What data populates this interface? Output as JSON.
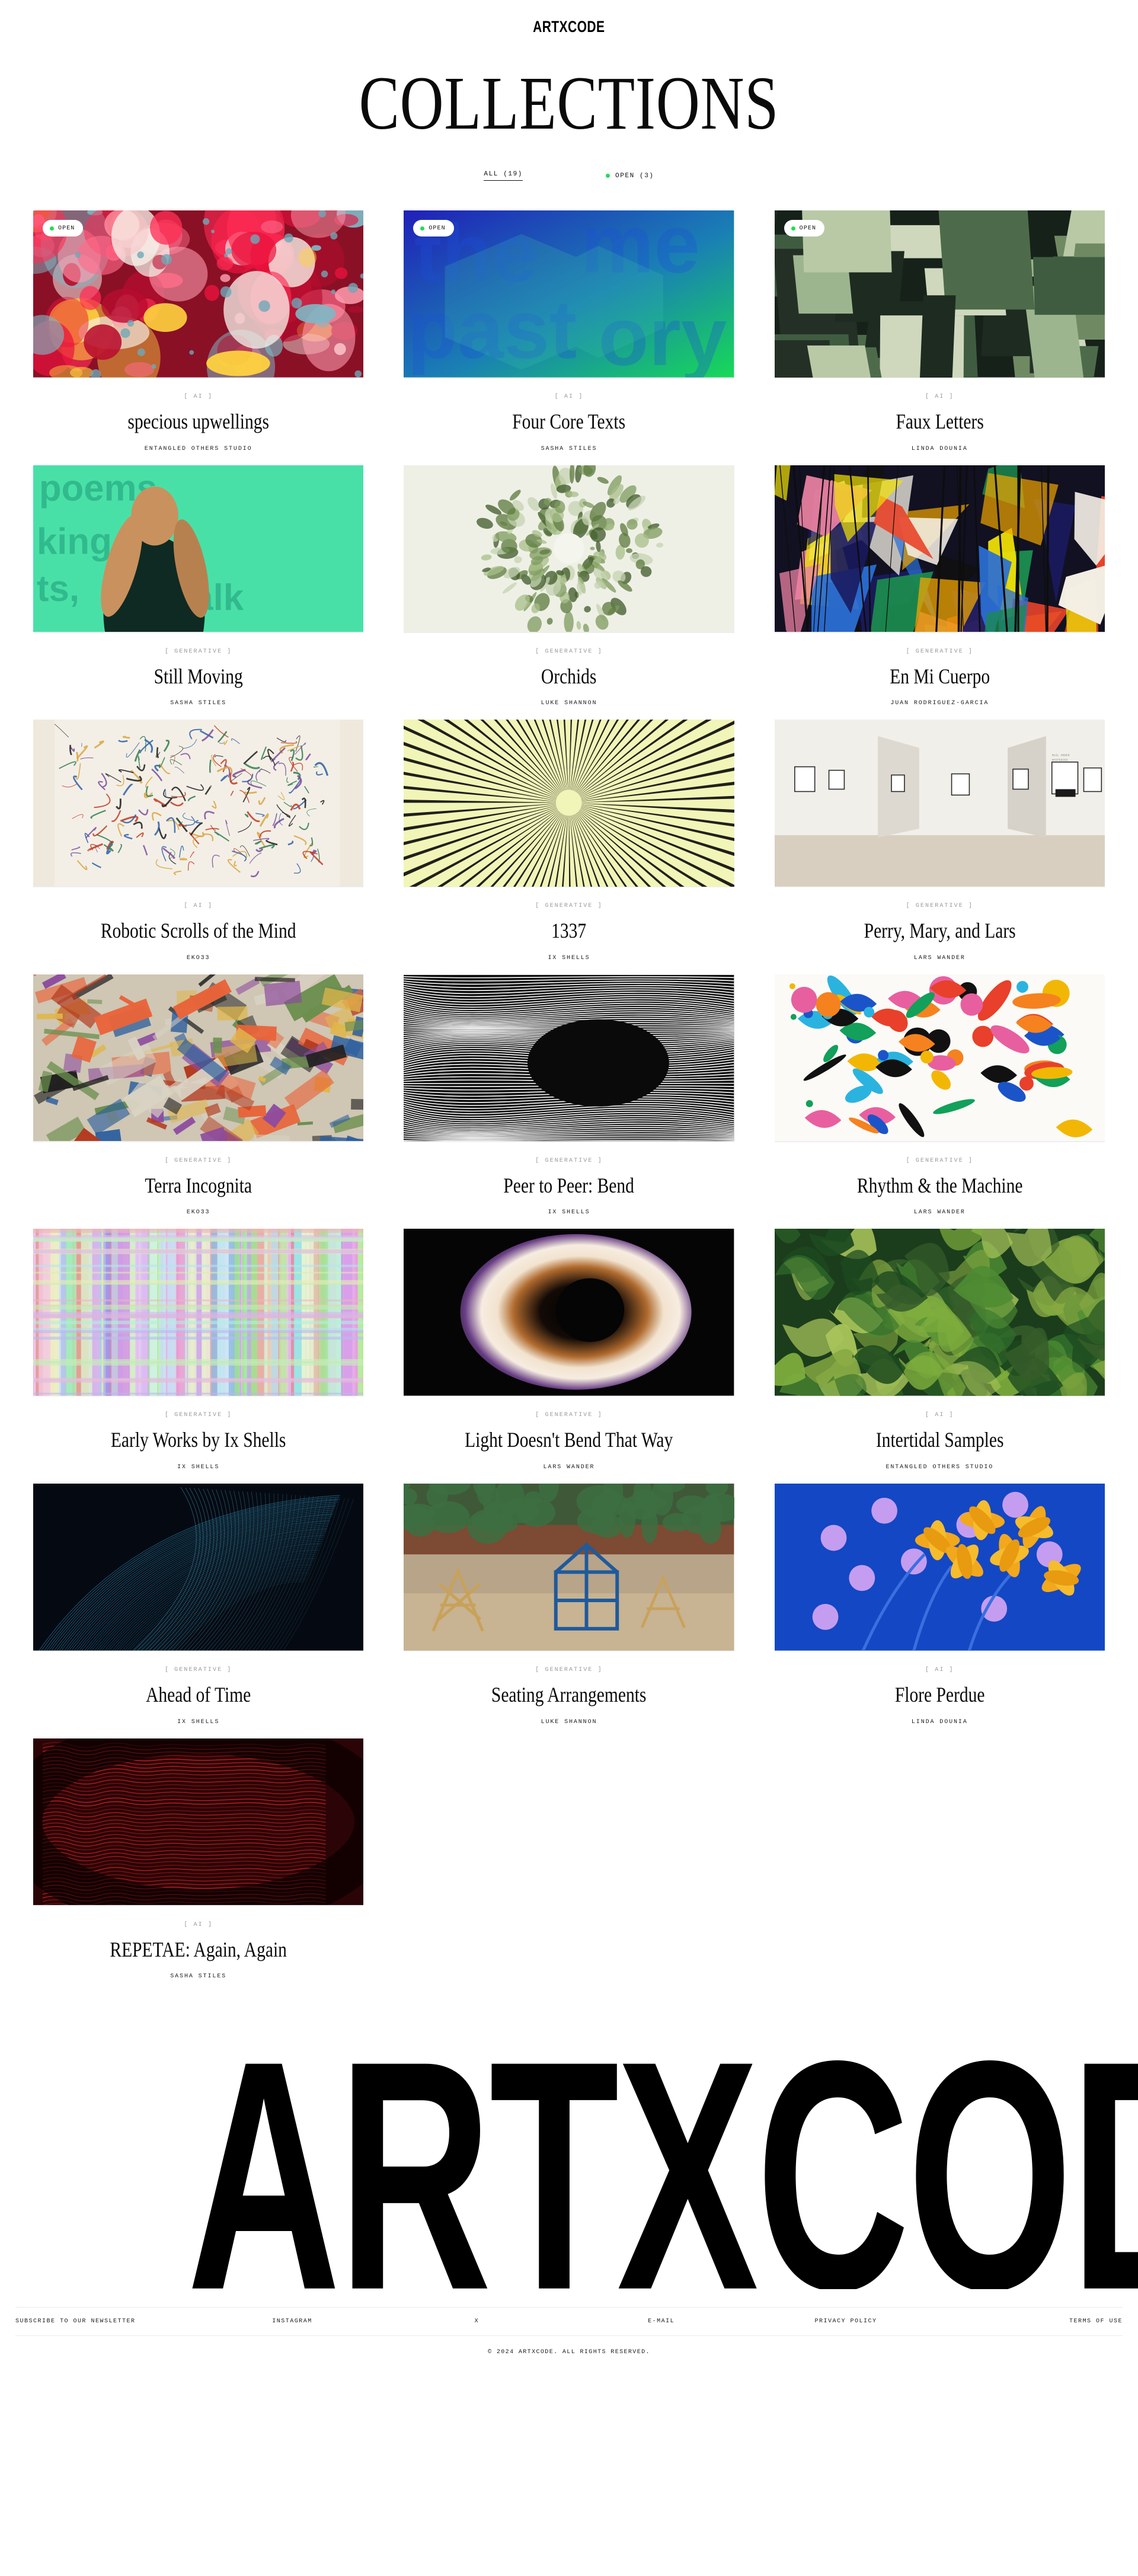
{
  "header": {
    "logo": "ARTXCODE"
  },
  "page": {
    "title": "COLLECTIONS"
  },
  "filters": [
    {
      "label": "ALL (19)",
      "active": true,
      "dot": false
    },
    {
      "label": "OPEN (3)",
      "active": false,
      "dot": true
    }
  ],
  "badge": {
    "open_label": "OPEN"
  },
  "colors": {
    "accent_green": "#22dd55",
    "text": "#0a0a0a",
    "muted": "#9a9a9a",
    "rule": "#ececec"
  },
  "collections": [
    {
      "title": "specious upwellings",
      "category": "[ AI ]",
      "artist": "ENTANGLED OTHERS STUDIO",
      "open": true,
      "art": "coral-bloom"
    },
    {
      "title": "Four Core Texts",
      "category": "[ AI ]",
      "artist": "SASHA STILES",
      "open": true,
      "art": "blue-green-type"
    },
    {
      "title": "Faux Letters",
      "category": "[ AI ]",
      "artist": "LINDA DOUNIA",
      "open": true,
      "art": "green-blocks"
    },
    {
      "title": "Still Moving",
      "category": "[ GENERATIVE ]",
      "artist": "SASHA STILES",
      "open": false,
      "art": "green-figure"
    },
    {
      "title": "Orchids",
      "category": "[ GENERATIVE ]",
      "artist": "LUKE SHANNON",
      "open": false,
      "art": "orchid-mandala"
    },
    {
      "title": "En Mi Cuerpo",
      "category": "[ GENERATIVE ]",
      "artist": "JUAN RODRIGUEZ-GARCIA",
      "open": false,
      "art": "shard-collage"
    },
    {
      "title": "Robotic Scrolls of the Mind",
      "category": "[ AI ]",
      "artist": "EKO33",
      "open": false,
      "art": "scribble-scroll"
    },
    {
      "title": "1337",
      "category": "[ GENERATIVE ]",
      "artist": "IX SHELLS",
      "open": false,
      "art": "yellow-rays"
    },
    {
      "title": "Perry, Mary, and Lars",
      "category": "[ GENERATIVE ]",
      "artist": "LARS WANDER",
      "open": false,
      "art": "gallery-room"
    },
    {
      "title": "Terra Incognita",
      "category": "[ GENERATIVE ]",
      "artist": "EKO33",
      "open": false,
      "art": "paint-strokes"
    },
    {
      "title": "Peer to Peer: Bend",
      "category": "[ GENERATIVE ]",
      "artist": "IX SHELLS",
      "open": false,
      "art": "black-lines"
    },
    {
      "title": "Rhythm & the Machine",
      "category": "[ GENERATIVE ]",
      "artist": "LARS WANDER",
      "open": false,
      "art": "confetti-shapes"
    },
    {
      "title": "Early Works by Ix Shells",
      "category": "[ GENERATIVE ]",
      "artist": "IX SHELLS",
      "open": false,
      "art": "pastel-glitch"
    },
    {
      "title": "Light Doesn't Bend That Way",
      "category": "[ GENERATIVE ]",
      "artist": "LARS WANDER",
      "open": false,
      "art": "light-tunnel"
    },
    {
      "title": "Intertidal Samples",
      "category": "[ AI ]",
      "artist": "ENTANGLED OTHERS STUDIO",
      "open": false,
      "art": "kelp-green"
    },
    {
      "title": "Ahead of Time",
      "category": "[ GENERATIVE ]",
      "artist": "IX SHELLS",
      "open": false,
      "art": "dark-wireframe"
    },
    {
      "title": "Seating Arrangements",
      "category": "[ GENERATIVE ]",
      "artist": "LUKE SHANNON",
      "open": false,
      "art": "garden-structures"
    },
    {
      "title": "Flore Perdue",
      "category": "[ AI ]",
      "artist": "LINDA DOUNIA",
      "open": false,
      "art": "blue-flowers"
    },
    {
      "title": "REPETAE: Again, Again",
      "category": "[ AI ]",
      "artist": "SASHA STILES",
      "open": false,
      "art": "red-script"
    }
  ],
  "wordmark": {
    "text": "ARTXCODE"
  },
  "footer": {
    "links": [
      "SUBSCRIBE TO OUR NEWSLETTER",
      "INSTAGRAM",
      "X",
      "E-MAIL",
      "PRIVACY POLICY",
      "TERMS OF USE"
    ],
    "copyright": "© 2024 ARTXCODE. ALL RIGHTS RESERVED."
  }
}
